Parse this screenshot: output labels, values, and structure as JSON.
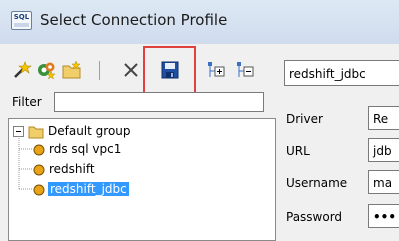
{
  "window": {
    "title": "Select Connection Profile",
    "icon_label": "SQL"
  },
  "toolbar": {
    "buttons": [
      {
        "name": "new-profile-button",
        "icon": "new-profile-icon"
      },
      {
        "name": "new-group-button",
        "icon": "new-group-icon"
      },
      {
        "name": "new-folder-button",
        "icon": "new-folder-icon"
      },
      {
        "name": "delete-button",
        "icon": "delete-x-icon"
      },
      {
        "name": "save-button",
        "icon": "floppy-disk-icon",
        "highlighted": true
      },
      {
        "name": "expand-all-button",
        "icon": "expand-tree-icon"
      },
      {
        "name": "collapse-all-button",
        "icon": "collapse-tree-icon"
      }
    ]
  },
  "filter": {
    "label": "Filter",
    "value": ""
  },
  "tree": {
    "group": {
      "label": "Default group",
      "expanded": true
    },
    "items": [
      {
        "label": "rds sql vpc1",
        "selected": false
      },
      {
        "label": "redshift",
        "selected": false
      },
      {
        "label": "redshift_jdbc",
        "selected": true
      }
    ]
  },
  "profile": {
    "name_value": "redshift_jdbc",
    "fields": [
      {
        "label": "Driver",
        "value": "Re"
      },
      {
        "label": "URL",
        "value": "jdb"
      },
      {
        "label": "Username",
        "value": "ma"
      },
      {
        "label": "Password",
        "value": "•••"
      }
    ]
  },
  "colors": {
    "highlight": "#e0403f",
    "selection": "#3399ff",
    "titlebar": "#d5e2f0"
  }
}
